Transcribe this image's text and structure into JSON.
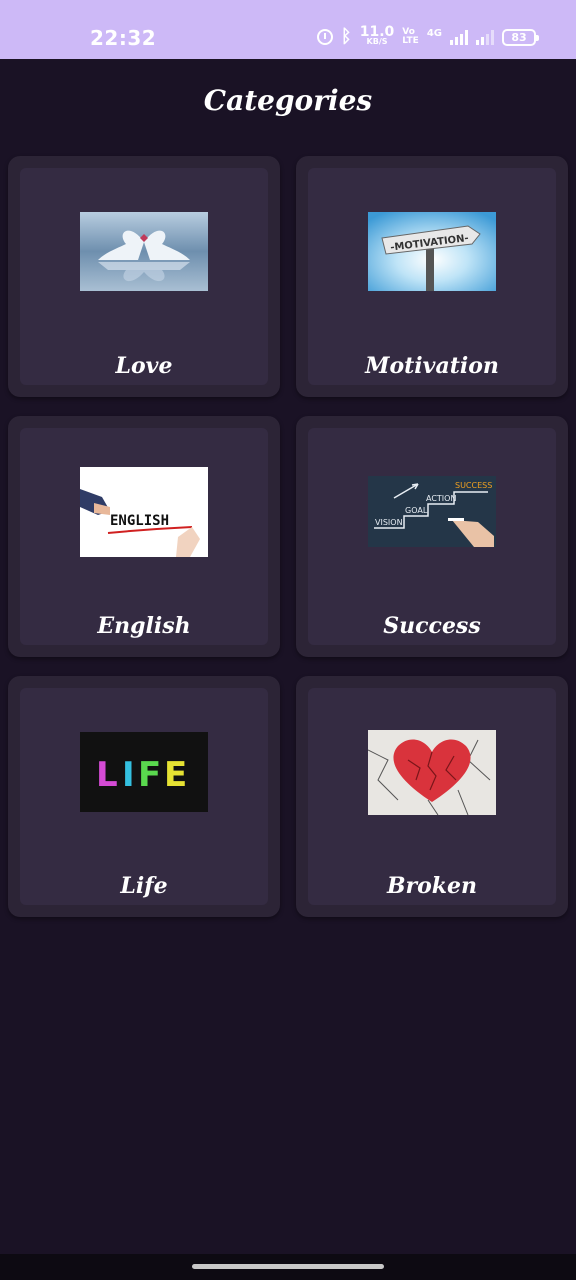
{
  "status_bar": {
    "time": "22:32",
    "net_speed_value": "11.0",
    "net_speed_unit": "KB/S",
    "volte_top": "Vo",
    "volte_bottom": "LTE",
    "network_type": "4G",
    "battery": "83"
  },
  "header": {
    "title": "Categories"
  },
  "categories": [
    {
      "label": "Love",
      "icon": "swans-heart-image"
    },
    {
      "label": "Motivation",
      "icon": "motivation-sign-image"
    },
    {
      "label": "English",
      "icon": "english-writing-image"
    },
    {
      "label": "Success",
      "icon": "success-steps-image"
    },
    {
      "label": "Life",
      "icon": "life-neon-image"
    },
    {
      "label": "Broken",
      "icon": "broken-heart-image"
    }
  ],
  "thumbs": {
    "motivation_text": "-MOTIVATION-",
    "english_text": "ENGLISH",
    "steps": [
      "VISION",
      "GOAL",
      "ACTION",
      "SUCCESS"
    ],
    "life_text": [
      "L",
      "I",
      "F",
      "E"
    ]
  },
  "colors": {
    "background": "#1a1225",
    "status_bar": "#cdb9f7",
    "card": "#2c2436",
    "card_inner": "#342b42"
  }
}
